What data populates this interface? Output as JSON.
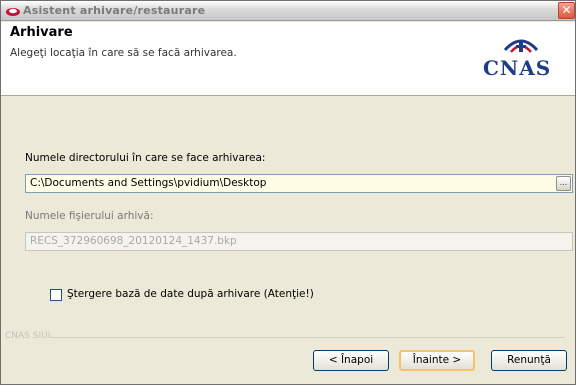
{
  "window": {
    "title": "Asistent arhivare/restaurare",
    "close_glyph": "✕"
  },
  "header": {
    "title": "Arhivare",
    "subtitle": "Alegeţi locaţia în care să se facă arhivarea.",
    "logo_text": "CNAS"
  },
  "form": {
    "directory_label": "Numele directorului în care se face arhivarea:",
    "directory_value": "C:\\Documents and Settings\\pvidium\\Desktop",
    "browse_label": "...",
    "archive_label": "Numele fişierului arhivă:",
    "archive_value": "RECS_372960698_20120124_1437.bkp",
    "delete_checkbox_label": "Ştergere bază de date după arhivare (Atenţie!)",
    "delete_checked": false
  },
  "footer": {
    "brand": "CNAS SIUI"
  },
  "buttons": {
    "back": "< Înapoi",
    "next": "Înainte >",
    "cancel": "Renunţă"
  },
  "icons": {
    "app": "archive-wizard-icon",
    "close": "close-icon",
    "logo": "cnas-logo"
  },
  "colors": {
    "logo_blue": "#1f3c88",
    "logo_red": "#c8102e",
    "field_bg": "#fffde6"
  }
}
